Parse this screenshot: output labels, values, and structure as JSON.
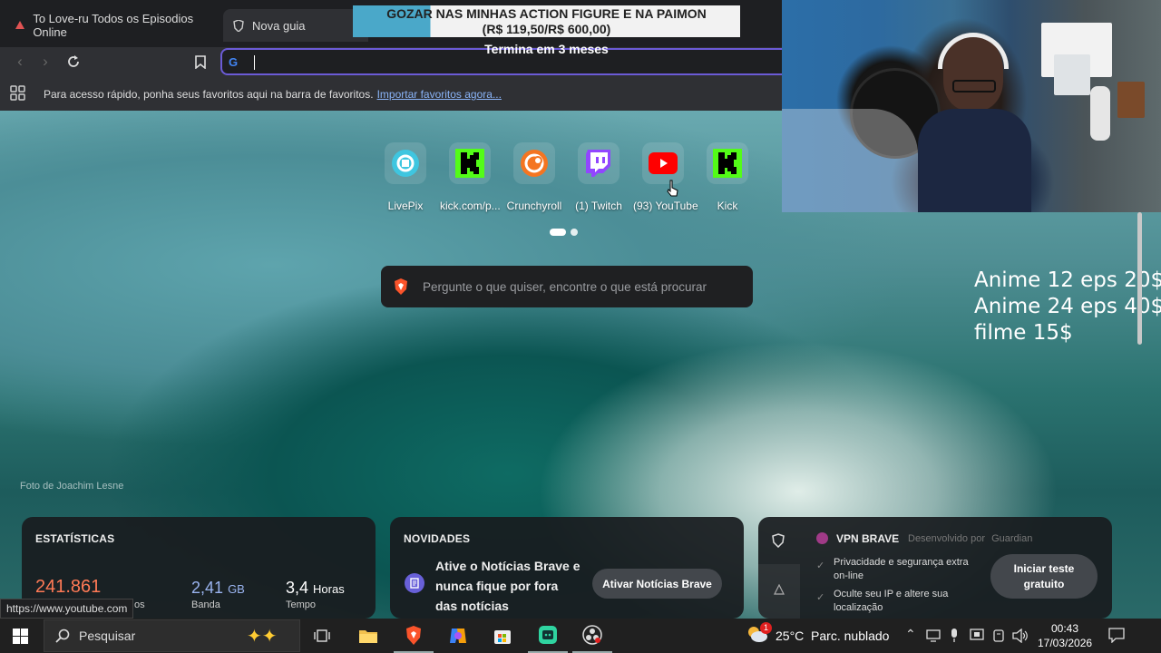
{
  "tabs": [
    {
      "label": "To Love-ru Todos os Episodios Online",
      "active": false
    },
    {
      "label": "Nova guia",
      "active": true
    }
  ],
  "promo": {
    "line1": "GOZAR NAS MINHAS ACTION FIGURE E NA PAIMON",
    "line2": "(R$ 119,50/R$ 600,00)",
    "progress": 0.2,
    "sub": "Termina em 3 meses"
  },
  "bookmarks_bar": {
    "text": "Para acesso rápido, ponha seus favoritos aqui na barra de favoritos.",
    "link": "Importar favoritos agora..."
  },
  "shortcuts": [
    {
      "label": "LivePix",
      "icon": "livepix-icon",
      "color": "#3fc6e0"
    },
    {
      "label": "kick.com/p...",
      "icon": "kick-icon",
      "color": "#53fc18"
    },
    {
      "label": "Crunchyroll",
      "icon": "crunchyroll-icon",
      "color": "#f47521"
    },
    {
      "label": "(1) Twitch",
      "icon": "twitch-icon",
      "color": "#9146ff"
    },
    {
      "label": "(93) YouTube",
      "icon": "youtube-icon",
      "color": "#ff0000"
    },
    {
      "label": "Kick",
      "icon": "kick-icon",
      "color": "#53fc18"
    }
  ],
  "search": {
    "placeholder": "Pergunte o que quiser, encontre o que está procurar"
  },
  "photo_credit": "Foto de Joachim Lesne",
  "price_overlay": [
    "Anime 12 eps 20$",
    "Anime 24 eps 40$",
    "filme 15$"
  ],
  "stats": {
    "title": "ESTATÍSTICAS",
    "items": [
      {
        "value": "241.861",
        "unit": "",
        "label": "os"
      },
      {
        "value": "2,41",
        "unit": "GB",
        "label": "Banda"
      },
      {
        "value": "3,4",
        "unit": "Horas",
        "label": "Tempo"
      }
    ]
  },
  "news": {
    "title": "NOVIDADES",
    "text": "Ative o Notícias Brave e nunca fique por fora das notícias",
    "button": "Ativar Notícias Brave"
  },
  "vpn": {
    "title": "VPN BRAVE",
    "dev": "Desenvolvido por",
    "brand": "Guardian",
    "features": [
      "Privacidade e segurança extra on-line",
      "Oculte seu IP e altere sua localização"
    ],
    "button": "Iniciar teste gratuito"
  },
  "status_url": "https://www.youtube.com",
  "taskbar": {
    "search": "Pesquisar",
    "weather": "25°C  Parc. nublado",
    "weather_badge": "1",
    "time": "00:43",
    "date": "17/03/2026"
  }
}
